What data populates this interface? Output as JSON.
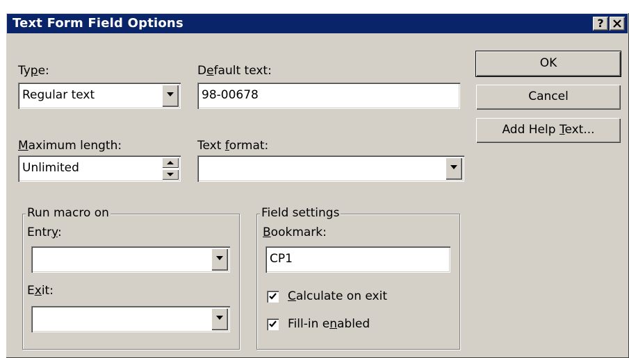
{
  "window": {
    "title": "Text Form Field Options",
    "help_button": "?",
    "close_button": "✕"
  },
  "type": {
    "label_pre": "Ty",
    "label_key": "p",
    "label_post": "e:",
    "value": "Regular text"
  },
  "default_text": {
    "label_pre": "D",
    "label_key": "e",
    "label_post": "fault text:",
    "value": "98-00678"
  },
  "maximum_length": {
    "label_pre": "",
    "label_key": "M",
    "label_post": "aximum length:",
    "value": "Unlimited"
  },
  "text_format": {
    "label_pre": "Text ",
    "label_key": "f",
    "label_post": "ormat:",
    "value": ""
  },
  "run_macro": {
    "legend": "Run macro on",
    "entry_label_pre": "Entr",
    "entry_label_key": "y",
    "entry_label_post": ":",
    "entry_value": "",
    "exit_label_pre": "E",
    "exit_label_key": "x",
    "exit_label_post": "it:",
    "exit_value": ""
  },
  "field_settings": {
    "legend": "Field settings",
    "bookmark_label_pre": "",
    "bookmark_label_key": "B",
    "bookmark_label_post": "ookmark:",
    "bookmark_value": "CP1",
    "calc_label_pre": "",
    "calc_label_key": "C",
    "calc_label_post": "alculate on exit",
    "calc_checked": true,
    "fill_label_pre": "Fill-in e",
    "fill_label_key": "n",
    "fill_label_post": "abled",
    "fill_checked": true
  },
  "buttons": {
    "ok": "OK",
    "cancel": "Cancel",
    "help_pre": "Add Help ",
    "help_key": "T",
    "help_post": "ext..."
  },
  "colors": {
    "titlebar": "#0a246a",
    "face": "#d4d0c8"
  }
}
